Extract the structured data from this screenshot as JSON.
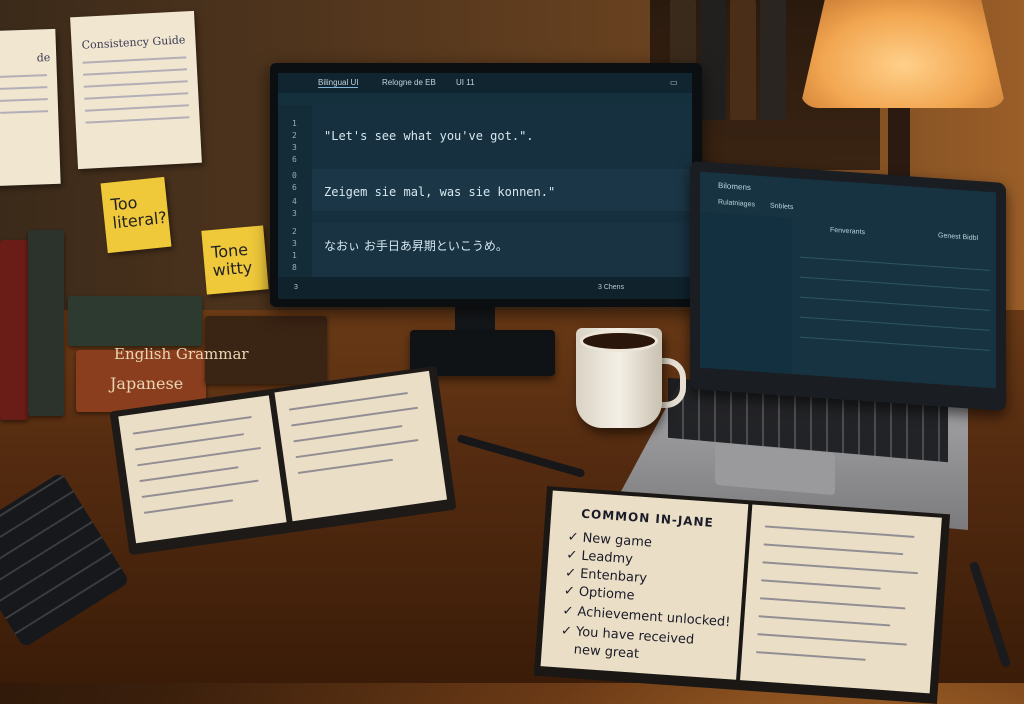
{
  "wall_notes": {
    "consistency_guide": {
      "title": "Consistency Guide"
    },
    "left_note": {
      "text": "de"
    }
  },
  "sticky_notes": [
    {
      "text": "Too literal?"
    },
    {
      "text": "Tone witty"
    }
  ],
  "books": [
    {
      "label": "English Grammar"
    },
    {
      "label": "Japanese"
    }
  ],
  "monitor": {
    "tabs": [
      "Bilingual UI",
      "Relogne de EB",
      "UI 11"
    ],
    "line_numbers": {
      "group1": [
        "1",
        "2",
        "3",
        "6"
      ],
      "group2": [
        "0",
        "6",
        "4",
        "3"
      ],
      "group3": [
        "2",
        "3",
        "1",
        "8"
      ]
    },
    "lines": [
      "\"Let's see what you've got.\".",
      "Zeigem sie mal, was sie konnen.\"",
      "なおぃ お手日あ昇期といこうめ。"
    ],
    "status": {
      "left": "3",
      "center": "3 Chens"
    }
  },
  "laptop": {
    "app_title": "Bilomens",
    "toolbar": [
      "Rulatniages",
      "Snblets"
    ],
    "panel_title": "Fenverants",
    "side_button": "Genest Bidbl"
  },
  "notebook_right": {
    "title": "COMMON IN-JANE",
    "items": [
      "New game",
      "Leadmy",
      "Entenbary",
      "Optiome",
      "Achievement unlocked!",
      "You have received",
      "new great"
    ]
  },
  "colors": {
    "screen_bg": "#17303f",
    "sticky": "#f0c93a",
    "lamp": "#f2a650"
  }
}
